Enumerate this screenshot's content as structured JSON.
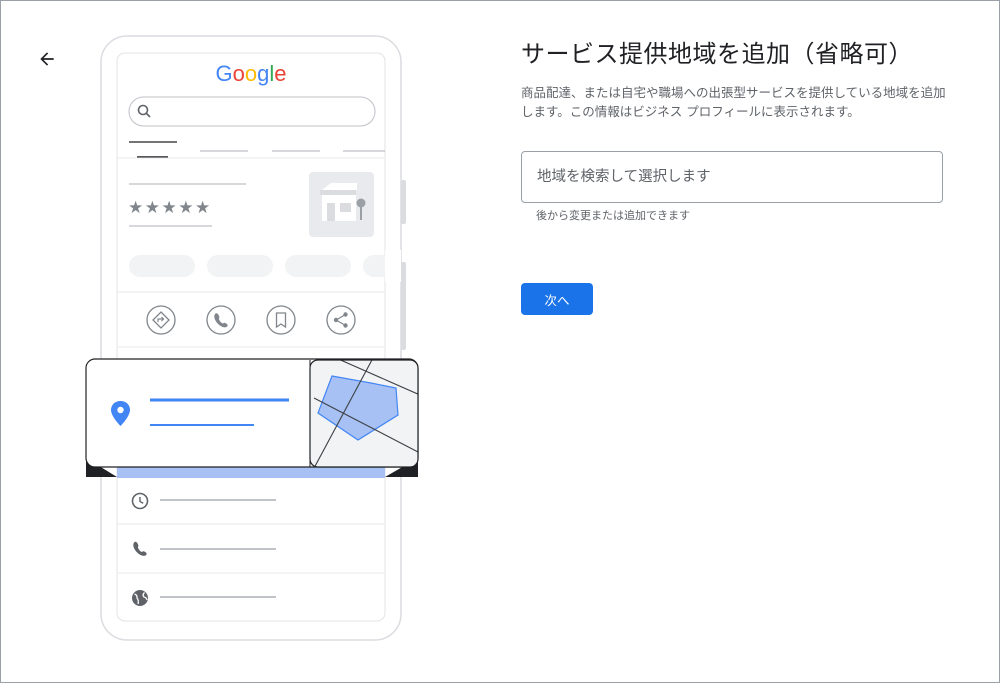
{
  "header": {
    "back_icon": "arrow-left-icon"
  },
  "illustration": {
    "brand": "Google",
    "brand_colors": [
      "#4285F4",
      "#EA4335",
      "#FBBC05",
      "#4285F4",
      "#34A853",
      "#EA4335"
    ],
    "rating_stars": "★★★★★",
    "action_icons": [
      "directions-icon",
      "phone-icon",
      "bookmark-icon",
      "share-icon"
    ],
    "info_icons": [
      "clock-icon",
      "phone-icon",
      "globe-icon"
    ],
    "accent_color": "#4285F4",
    "area_fill": "#a8c1f5"
  },
  "main": {
    "title": "サービス提供地域を追加（省略可）",
    "description": "商品配達、または自宅や職場への出張型サービスを提供している地域を追加します。この情報はビジネス プロフィールに表示されます。",
    "search": {
      "value": "",
      "placeholder": "地域を検索して選択します"
    },
    "helper_text": "後から変更または追加できます",
    "next_label": "次へ"
  }
}
